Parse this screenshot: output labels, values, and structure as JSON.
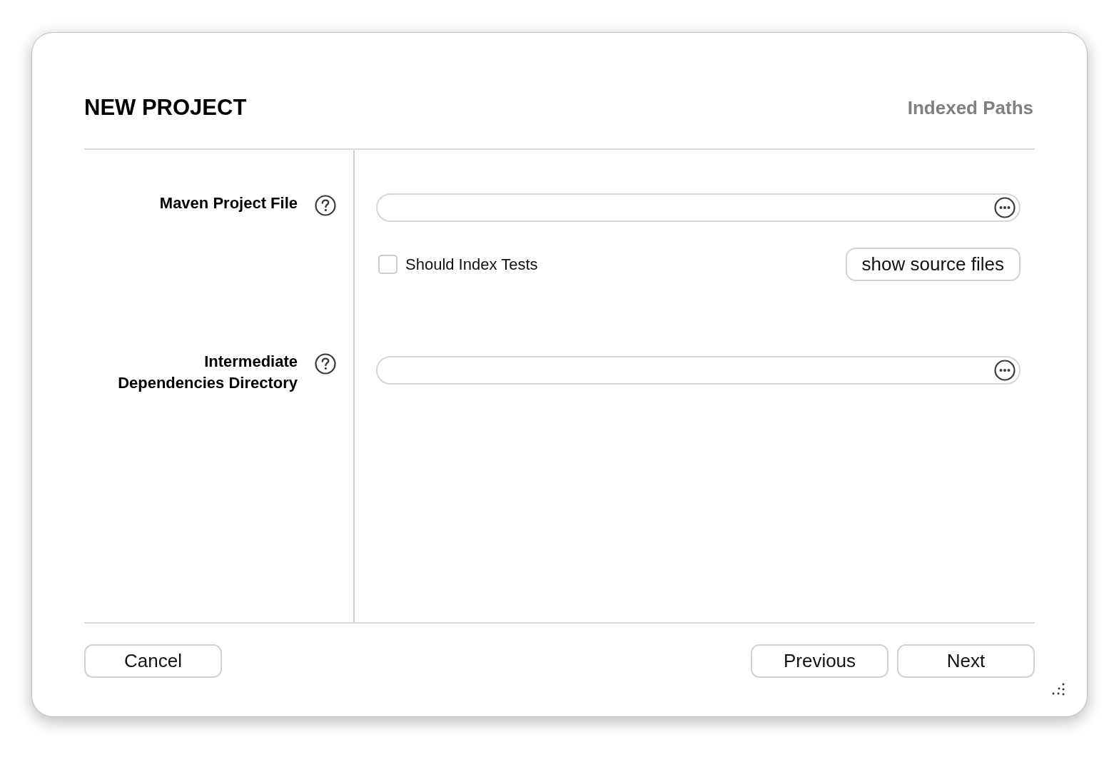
{
  "window": {
    "title": "NEW PROJECT",
    "step": "Indexed Paths"
  },
  "rows": [
    {
      "label": "Maven Project File",
      "checkbox": {
        "label": "Should Index Tests",
        "checked": false
      },
      "button": {
        "label": "show source files"
      }
    },
    {
      "label": "Intermediate Dependencies Directory"
    }
  ],
  "footer": {
    "left_buttons": [
      {
        "label": "Cancel"
      }
    ],
    "right_buttons": [
      {
        "label": "Previous"
      },
      {
        "label": "Next"
      }
    ]
  }
}
